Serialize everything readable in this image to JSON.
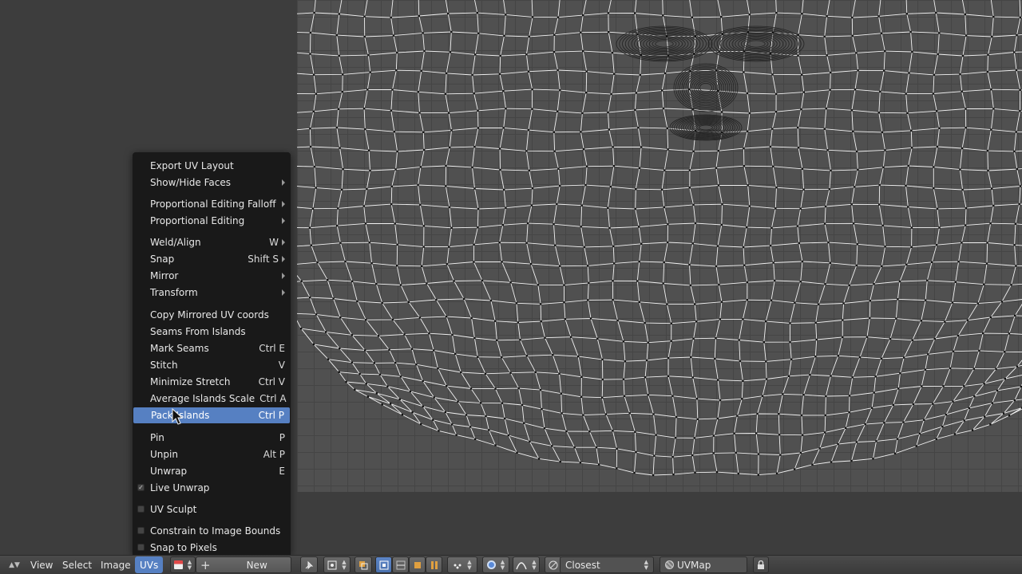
{
  "header": {
    "menus": {
      "view": "View",
      "select": "Select",
      "image": "Image",
      "uvs": "UVs"
    },
    "new_label": "New",
    "snap_target": "Closest",
    "uv_map": "UVMap"
  },
  "menu": {
    "items": [
      {
        "label": "Export UV Layout",
        "shortcut": "",
        "submenu": false
      },
      {
        "label": "Show/Hide Faces",
        "shortcut": "",
        "submenu": true
      },
      {
        "label": "Proportional Editing Falloff",
        "shortcut": "",
        "submenu": true
      },
      {
        "label": "Proportional Editing",
        "shortcut": "",
        "submenu": true
      },
      {
        "label": "Weld/Align",
        "shortcut": "W",
        "submenu": true
      },
      {
        "label": "Snap",
        "shortcut": "Shift S",
        "submenu": true
      },
      {
        "label": "Mirror",
        "shortcut": "",
        "submenu": true
      },
      {
        "label": "Transform",
        "shortcut": "",
        "submenu": true
      },
      {
        "label": "Copy Mirrored UV coords",
        "shortcut": ""
      },
      {
        "label": "Seams From Islands",
        "shortcut": ""
      },
      {
        "label": "Mark Seams",
        "shortcut": "Ctrl E"
      },
      {
        "label": "Stitch",
        "shortcut": "V"
      },
      {
        "label": "Minimize Stretch",
        "shortcut": "Ctrl V"
      },
      {
        "label": "Average Islands Scale",
        "shortcut": "Ctrl A"
      },
      {
        "label": "Pack Islands",
        "shortcut": "Ctrl P",
        "highlighted": true
      },
      {
        "label": "Pin",
        "shortcut": "P"
      },
      {
        "label": "Unpin",
        "shortcut": "Alt P"
      },
      {
        "label": "Unwrap",
        "shortcut": "E"
      },
      {
        "label": "Live Unwrap",
        "checkbox": true,
        "checked": true
      },
      {
        "label": "UV Sculpt",
        "checkbox": true,
        "checked": false
      },
      {
        "label": "Constrain to Image Bounds",
        "checkbox": true,
        "checked": false
      },
      {
        "label": "Snap to Pixels",
        "checkbox": true,
        "checked": false
      }
    ]
  },
  "colors": {
    "accent": "#5680c2",
    "menu_bg": "#191919",
    "canvas_bg": "#505050"
  }
}
